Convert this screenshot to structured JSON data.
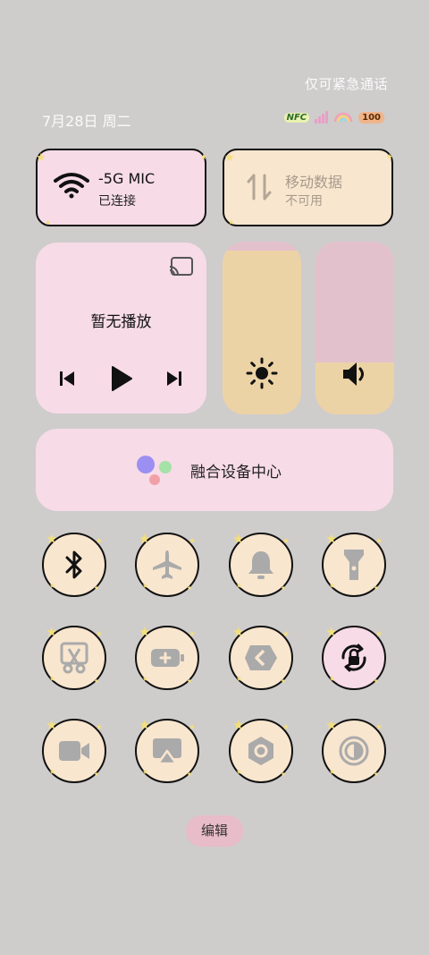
{
  "status_bar": {
    "emergency_text": "仅可紧急通话",
    "date": "7月28日 周二",
    "nfc_label": "NFC",
    "battery": "100"
  },
  "tiles": {
    "wifi": {
      "title": "-5G     MIC",
      "status": "已连接",
      "icon": "wifi-icon"
    },
    "mobile_data": {
      "title": "移动数据",
      "status": "不可用",
      "icon": "data-arrows-icon"
    }
  },
  "media": {
    "status": "暂无播放",
    "controls": [
      "previous-icon",
      "play-icon",
      "next-icon"
    ]
  },
  "sliders": {
    "brightness_level": 0.95,
    "volume_level": 0.3
  },
  "device_center": {
    "label": "融合设备中心"
  },
  "quick_toggles": [
    "bluetooth-icon",
    "airplane-icon",
    "bell-icon",
    "flashlight-icon",
    "screenshot-icon",
    "battery-saver-icon",
    "share-icon",
    "rotation-lock-icon",
    "screen-record-icon",
    "screencast-icon",
    "settings-icon",
    "dark-mode-icon"
  ],
  "edit_button": {
    "label": "编辑"
  },
  "colors": {
    "background": "#cfcccc",
    "pink_tile": "#f7dbe7",
    "beige_tile": "#f9e6cf",
    "slider_fill": "#ecd3a5",
    "slider_track": "#e3c1cc"
  }
}
